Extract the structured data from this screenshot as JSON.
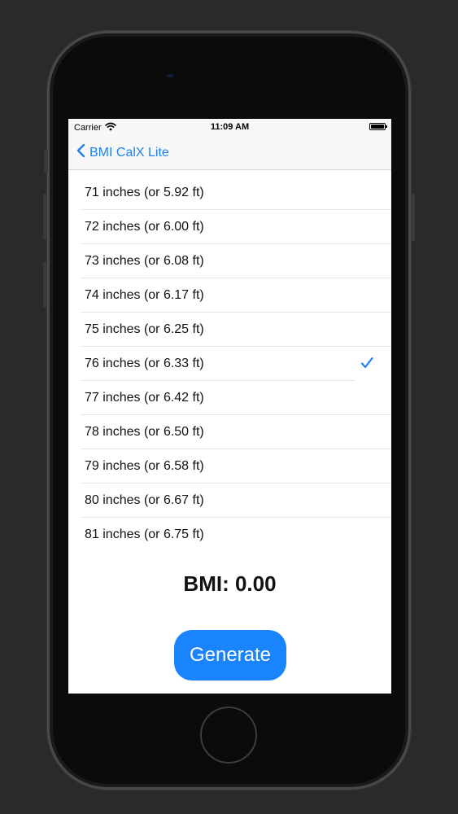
{
  "status_bar": {
    "carrier": "Carrier",
    "time": "11:09 AM"
  },
  "nav": {
    "back_label": "BMI CalX Lite",
    "accent_color": "#1f82ee"
  },
  "height_rows": [
    {
      "label": "71 inches (or 5.92 ft)",
      "selected": false
    },
    {
      "label": "72 inches (or 6.00 ft)",
      "selected": false
    },
    {
      "label": "73 inches (or 6.08 ft)",
      "selected": false
    },
    {
      "label": "74 inches (or 6.17 ft)",
      "selected": false
    },
    {
      "label": "75 inches (or 6.25 ft)",
      "selected": false
    },
    {
      "label": "76 inches (or 6.33 ft)",
      "selected": true
    },
    {
      "label": "77 inches (or 6.42 ft)",
      "selected": false
    },
    {
      "label": "78 inches (or 6.50 ft)",
      "selected": false
    },
    {
      "label": "79 inches (or 6.58 ft)",
      "selected": false
    },
    {
      "label": "80 inches (or 6.67 ft)",
      "selected": false
    },
    {
      "label": "81 inches (or 6.75 ft)",
      "selected": false
    }
  ],
  "result": {
    "bmi_text": "BMI: 0.00"
  },
  "actions": {
    "generate_label": "Generate",
    "button_color": "#1a84ff"
  },
  "icons": {
    "wifi": "wifi-icon",
    "battery": "battery-icon",
    "back": "chevron-left-icon",
    "check": "checkmark-icon"
  }
}
